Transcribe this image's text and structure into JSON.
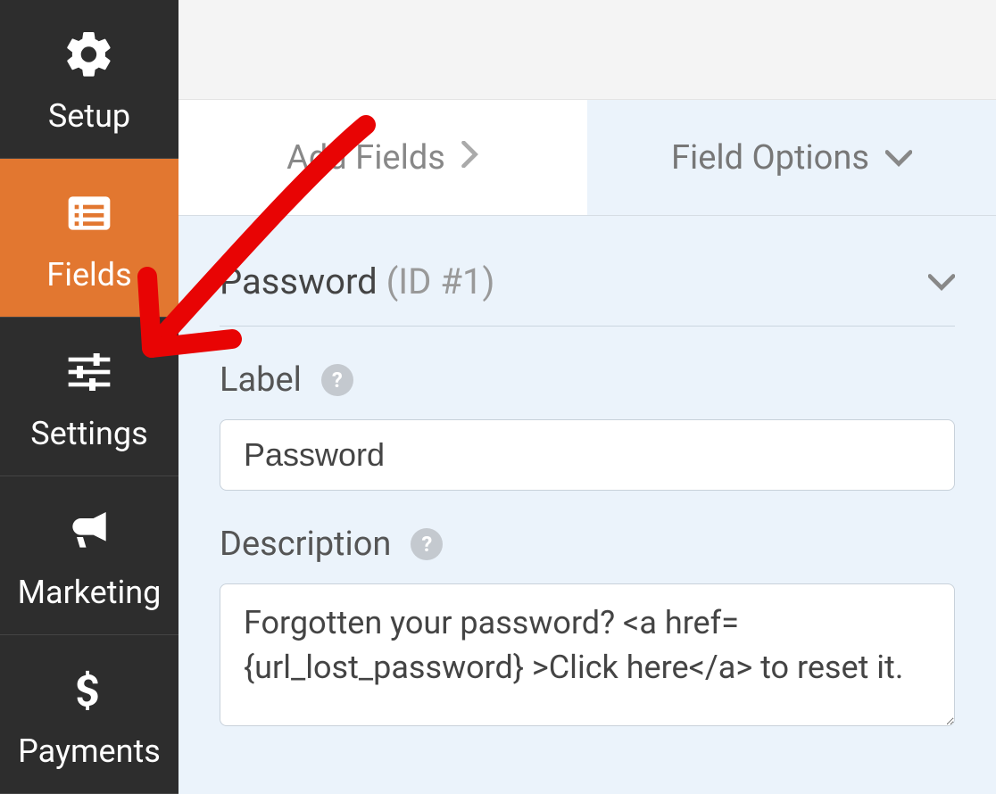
{
  "sidebar": {
    "items": [
      {
        "label": "Setup",
        "icon": "gear-icon",
        "active": false
      },
      {
        "label": "Fields",
        "icon": "list-icon",
        "active": true
      },
      {
        "label": "Settings",
        "icon": "sliders-icon",
        "active": false
      },
      {
        "label": "Marketing",
        "icon": "bullhorn-icon",
        "active": false
      },
      {
        "label": "Payments",
        "icon": "dollar-icon",
        "active": false
      }
    ]
  },
  "tabs": {
    "add_fields": "Add Fields",
    "field_options": "Field Options"
  },
  "panel": {
    "title": "Password",
    "id_text": "(ID #1)",
    "label_label": "Label",
    "label_value": "Password",
    "description_label": "Description",
    "description_value": "Forgotten your password? <a href={url_lost_password} >Click here</a> to reset it."
  },
  "colors": {
    "accent": "#e27730",
    "panel_bg": "#ebf3fb",
    "arrow": "#e80404"
  }
}
